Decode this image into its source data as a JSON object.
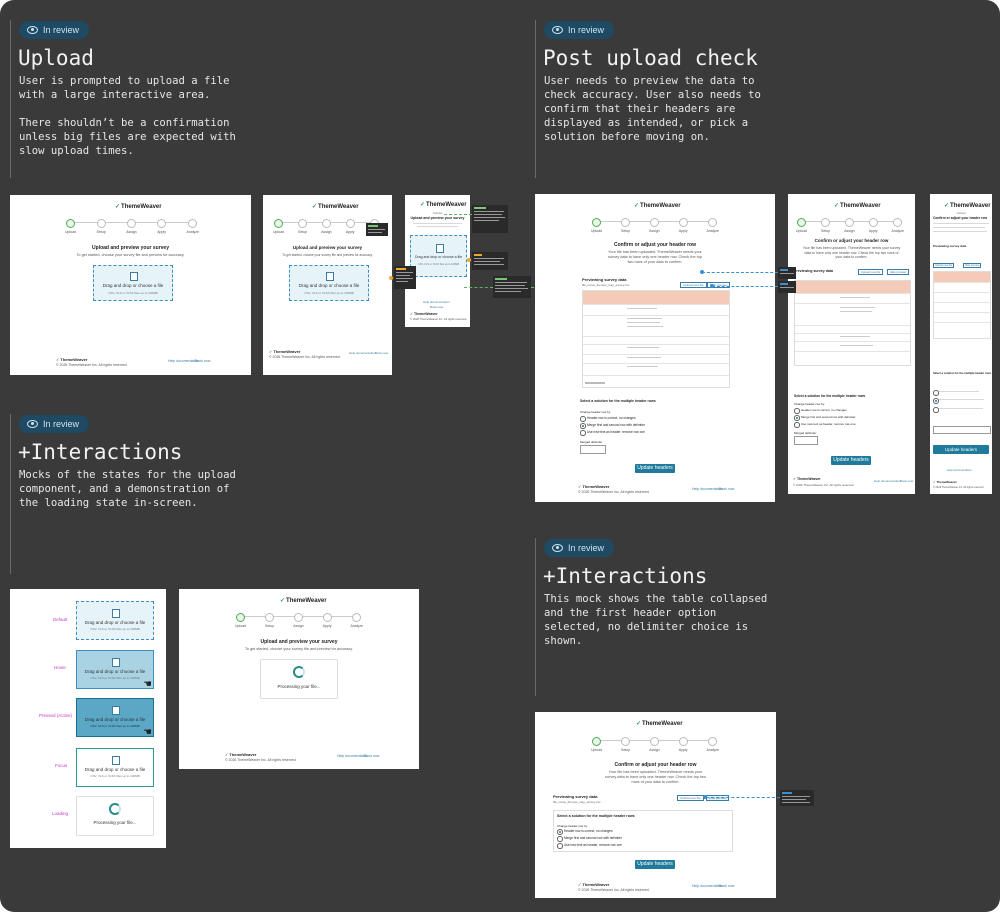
{
  "sections": {
    "upload": {
      "badge": "In review",
      "title": "Upload",
      "description": "User is prompted to upload a file\nwith a large interactive area.\n\nThere shouldn’t be a confirmation\nunless big files are expected with\nslow upload times."
    },
    "post_upload": {
      "badge": "In review",
      "title": "Post upload check",
      "description": "User needs to preview the data to\ncheck accuracy. User also needs to\nconfirm that their headers are\ndisplayed as intended, or pick a\nsolution before moving on."
    },
    "interactions1": {
      "badge": "In review",
      "title": "+Interactions",
      "description": "Mocks of the states for the upload\ncomponent, and a demonstration of\nthe loading state in-screen."
    },
    "interactions2": {
      "badge": "In review",
      "title": "+Interactions",
      "description": "This mock shows the table collapsed\nand the first header option\nselected, no delimiter choice is\nshown."
    }
  },
  "mock": {
    "brand": "ThemeWeaver",
    "steps": [
      "Upload",
      "Setup",
      "Assign",
      "Apply",
      "Analyze"
    ],
    "upload_title": "Upload and preview your survey",
    "upload_sub": "To get started, choose your survey file and preview for accuracy.",
    "drop_text": "Drag and drop or choose a file",
    "drop_small": "CSV, XLS or XLSX files up to 100MB",
    "processing": "Processing your file...",
    "footer_left": "© 2026 ThemeWeaver Inc. All rights reserved.",
    "footer_links": [
      "Help documentation",
      "Book now"
    ],
    "confirm_title": "Confirm or adjust your header row",
    "confirm_sub": "Your file has been uploaded. ThemeWeaver needs your survey data to have only one header row. Check the top two rows of your data to confirm.",
    "preview_label": "Previewing survey data",
    "file_name": "file_name_themes_may_survey.csv",
    "upload_new": "Upload new file",
    "hide_preview": "Hide preview",
    "solution_title": "Select a solution for the multiple header rows",
    "change_label": "Change header row by",
    "options": [
      "Header row is correct, no changes",
      "Merge first and second row with delimiter",
      "Use new text as header, remove row one"
    ],
    "delimiter_label": "Merged delimiter",
    "update_btn": "Update headers"
  },
  "states": [
    "Default",
    "Hover",
    "Pressed (Active)",
    "Focus",
    "Loading"
  ]
}
